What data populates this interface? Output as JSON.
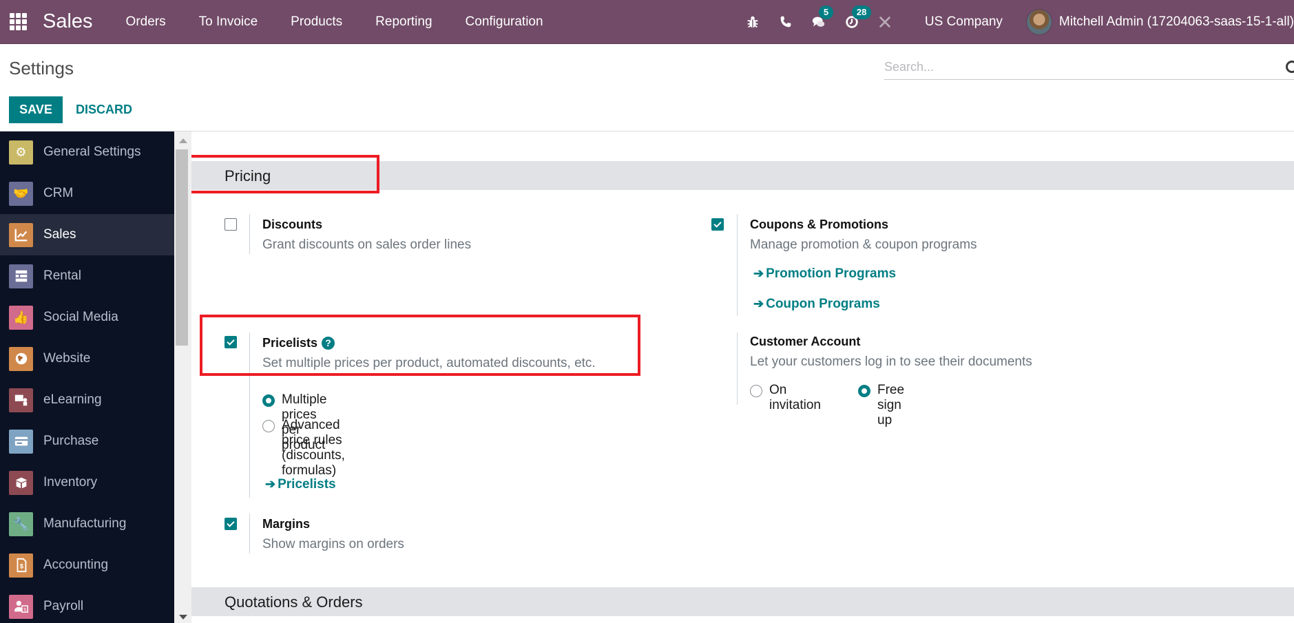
{
  "navbar": {
    "app_name": "Sales",
    "menu": [
      "Orders",
      "To Invoice",
      "Products",
      "Reporting",
      "Configuration"
    ],
    "icons": [
      "bug-icon",
      "phone-icon",
      "chat-icon",
      "activity-clock-icon",
      "tools-icon"
    ],
    "messages_badge": "5",
    "activities_badge": "28",
    "company": "US Company",
    "user": "Mitchell Admin (17204063-saas-15-1-all)"
  },
  "control_panel": {
    "title": "Settings",
    "save_label": "SAVE",
    "discard_label": "DISCARD",
    "search_placeholder": "Search..."
  },
  "sidebar": {
    "items": [
      {
        "label": "General Settings",
        "icon": "gear-icon",
        "color": "#c9b866",
        "active": false
      },
      {
        "label": "CRM",
        "icon": "handshake-icon",
        "color": "#6a6d95",
        "active": false
      },
      {
        "label": "Sales",
        "icon": "chart-up-icon",
        "color": "#d0884a",
        "active": true
      },
      {
        "label": "Rental",
        "icon": "calendar-grid-icon",
        "color": "#6a6d95",
        "active": false
      },
      {
        "label": "Social Media",
        "icon": "thumbs-up-icon",
        "color": "#d16b8c",
        "active": false
      },
      {
        "label": "Website",
        "icon": "globe-icon",
        "color": "#d0884a",
        "active": false
      },
      {
        "label": "eLearning",
        "icon": "presentation-icon",
        "color": "#8e4a52",
        "active": false
      },
      {
        "label": "Purchase",
        "icon": "credit-card-icon",
        "color": "#7fa3c2",
        "active": false
      },
      {
        "label": "Inventory",
        "icon": "box-icon",
        "color": "#8e4a52",
        "active": false
      },
      {
        "label": "Manufacturing",
        "icon": "wrench-icon",
        "color": "#6fae85",
        "active": false
      },
      {
        "label": "Accounting",
        "icon": "invoice-dollar-icon",
        "color": "#d0884a",
        "active": false
      },
      {
        "label": "Payroll",
        "icon": "payroll-icon",
        "color": "#d16b8c",
        "active": false
      }
    ]
  },
  "content": {
    "sections": [
      {
        "title": "Pricing"
      },
      {
        "title": "Quotations & Orders"
      }
    ],
    "settings": {
      "discounts": {
        "title": "Discounts",
        "desc": "Grant discounts on sales order lines",
        "checked": false
      },
      "coupons": {
        "title": "Coupons & Promotions",
        "desc": "Manage promotion & coupon programs",
        "checked": true,
        "links": [
          "Promotion Programs",
          "Coupon Programs"
        ]
      },
      "pricelists": {
        "title": "Pricelists",
        "desc": "Set multiple prices per product, automated discounts, etc.",
        "checked": true,
        "options": [
          {
            "label": "Multiple prices per product",
            "selected": true
          },
          {
            "label": "Advanced price rules",
            "label2": "(discounts, formulas)",
            "selected": false
          }
        ],
        "link": "Pricelists"
      },
      "customer_account": {
        "title": "Customer Account",
        "desc": "Let your customers log in to see their documents",
        "options": [
          {
            "label": "On invitation",
            "selected": false
          },
          {
            "label": "Free sign up",
            "selected": true
          }
        ]
      },
      "margins": {
        "title": "Margins",
        "desc": "Show margins on orders",
        "checked": true
      }
    }
  },
  "colors": {
    "brand": "#714b67",
    "accent": "#017e84",
    "highlight": "#ed1c24",
    "sidebar_bg": "#0b1224"
  }
}
